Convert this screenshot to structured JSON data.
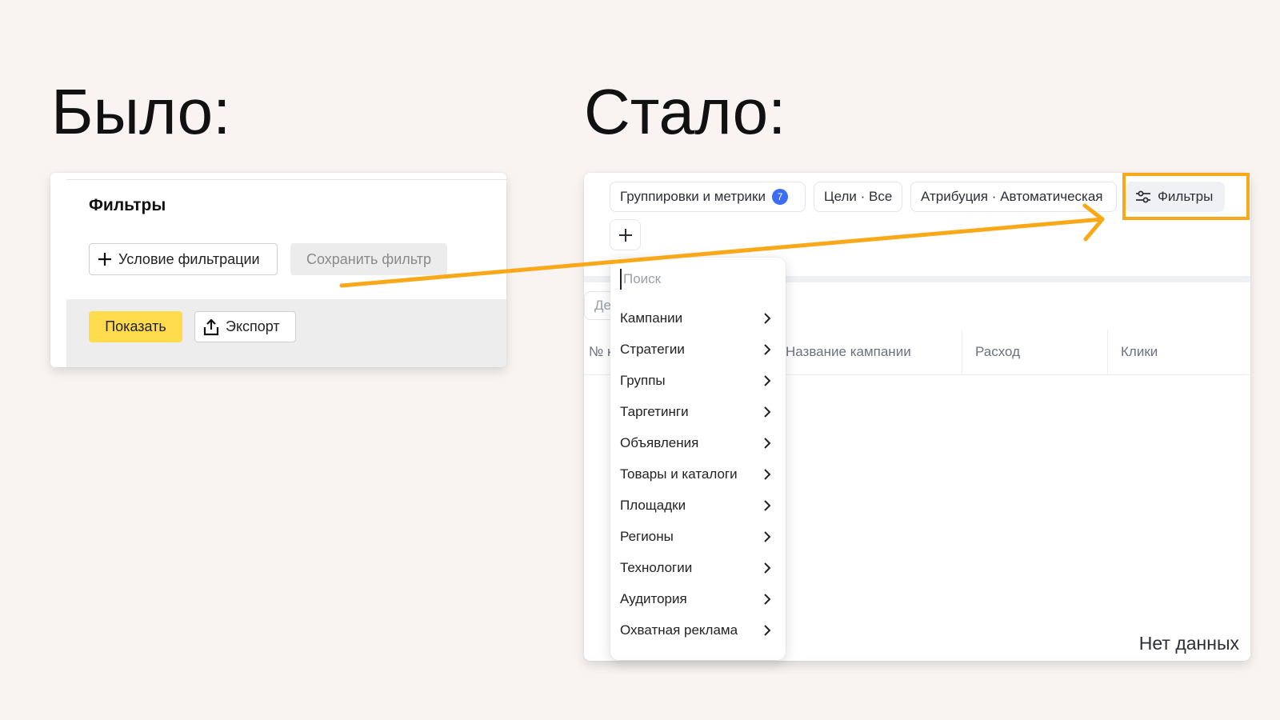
{
  "headings": {
    "before": "Было:",
    "after": "Стало:"
  },
  "before_panel": {
    "title": "Фильтры",
    "add_condition_label": "Условие фильтрации",
    "save_filter_label": "Сохранить фильтр",
    "show_label": "Показать",
    "export_label": "Экспорт"
  },
  "after_panel": {
    "toolbar": {
      "groupings_label": "Группировки и метрики",
      "groupings_count": "7",
      "goals_label": "Цели · Все",
      "attribution_label": "Атрибуция · Автоматическая",
      "filters_label": "Фильтры"
    },
    "partial_pill": "Де",
    "table": {
      "columns": [
        "№ к",
        "Название кампании",
        "Расход",
        "Клики"
      ],
      "empty_message": "Нет данных"
    },
    "dropdown": {
      "search_placeholder": "Поиск",
      "items": [
        "Кампании",
        "Стратегии",
        "Группы",
        "Таргетинги",
        "Объявления",
        "Товары и каталоги",
        "Площадки",
        "Регионы",
        "Технологии",
        "Аудитория",
        "Охватная реклама"
      ]
    }
  },
  "colors": {
    "background": "#f9f4f2",
    "accent_yellow": "#ffdb4d",
    "highlight_orange": "#f9a817",
    "badge_blue": "#3b6ef5"
  }
}
